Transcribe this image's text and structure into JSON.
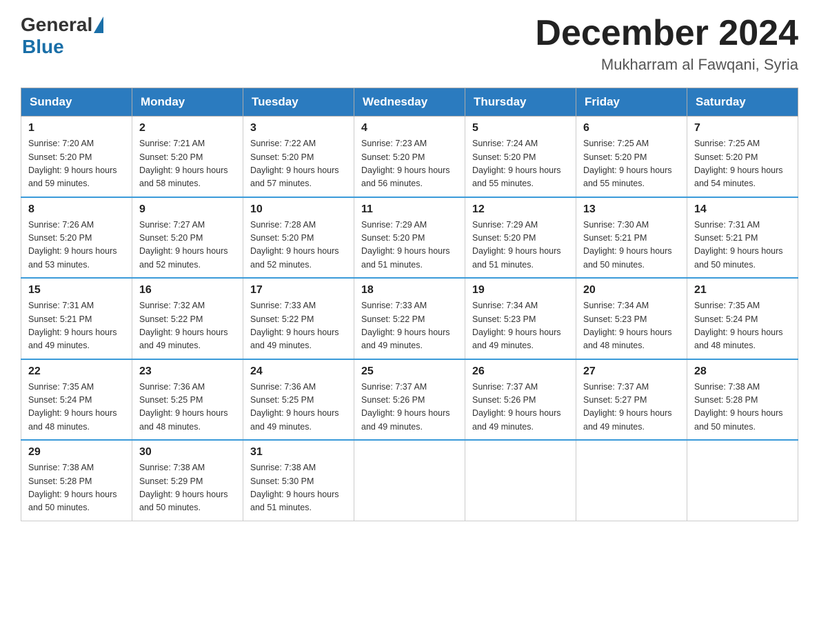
{
  "logo": {
    "general": "General",
    "blue": "Blue"
  },
  "header": {
    "month_title": "December 2024",
    "location": "Mukharram al Fawqani, Syria"
  },
  "weekdays": [
    "Sunday",
    "Monday",
    "Tuesday",
    "Wednesday",
    "Thursday",
    "Friday",
    "Saturday"
  ],
  "weeks": [
    [
      {
        "day": "1",
        "sunrise": "7:20 AM",
        "sunset": "5:20 PM",
        "daylight": "9 hours and 59 minutes."
      },
      {
        "day": "2",
        "sunrise": "7:21 AM",
        "sunset": "5:20 PM",
        "daylight": "9 hours and 58 minutes."
      },
      {
        "day": "3",
        "sunrise": "7:22 AM",
        "sunset": "5:20 PM",
        "daylight": "9 hours and 57 minutes."
      },
      {
        "day": "4",
        "sunrise": "7:23 AM",
        "sunset": "5:20 PM",
        "daylight": "9 hours and 56 minutes."
      },
      {
        "day": "5",
        "sunrise": "7:24 AM",
        "sunset": "5:20 PM",
        "daylight": "9 hours and 55 minutes."
      },
      {
        "day": "6",
        "sunrise": "7:25 AM",
        "sunset": "5:20 PM",
        "daylight": "9 hours and 55 minutes."
      },
      {
        "day": "7",
        "sunrise": "7:25 AM",
        "sunset": "5:20 PM",
        "daylight": "9 hours and 54 minutes."
      }
    ],
    [
      {
        "day": "8",
        "sunrise": "7:26 AM",
        "sunset": "5:20 PM",
        "daylight": "9 hours and 53 minutes."
      },
      {
        "day": "9",
        "sunrise": "7:27 AM",
        "sunset": "5:20 PM",
        "daylight": "9 hours and 52 minutes."
      },
      {
        "day": "10",
        "sunrise": "7:28 AM",
        "sunset": "5:20 PM",
        "daylight": "9 hours and 52 minutes."
      },
      {
        "day": "11",
        "sunrise": "7:29 AM",
        "sunset": "5:20 PM",
        "daylight": "9 hours and 51 minutes."
      },
      {
        "day": "12",
        "sunrise": "7:29 AM",
        "sunset": "5:20 PM",
        "daylight": "9 hours and 51 minutes."
      },
      {
        "day": "13",
        "sunrise": "7:30 AM",
        "sunset": "5:21 PM",
        "daylight": "9 hours and 50 minutes."
      },
      {
        "day": "14",
        "sunrise": "7:31 AM",
        "sunset": "5:21 PM",
        "daylight": "9 hours and 50 minutes."
      }
    ],
    [
      {
        "day": "15",
        "sunrise": "7:31 AM",
        "sunset": "5:21 PM",
        "daylight": "9 hours and 49 minutes."
      },
      {
        "day": "16",
        "sunrise": "7:32 AM",
        "sunset": "5:22 PM",
        "daylight": "9 hours and 49 minutes."
      },
      {
        "day": "17",
        "sunrise": "7:33 AM",
        "sunset": "5:22 PM",
        "daylight": "9 hours and 49 minutes."
      },
      {
        "day": "18",
        "sunrise": "7:33 AM",
        "sunset": "5:22 PM",
        "daylight": "9 hours and 49 minutes."
      },
      {
        "day": "19",
        "sunrise": "7:34 AM",
        "sunset": "5:23 PM",
        "daylight": "9 hours and 49 minutes."
      },
      {
        "day": "20",
        "sunrise": "7:34 AM",
        "sunset": "5:23 PM",
        "daylight": "9 hours and 48 minutes."
      },
      {
        "day": "21",
        "sunrise": "7:35 AM",
        "sunset": "5:24 PM",
        "daylight": "9 hours and 48 minutes."
      }
    ],
    [
      {
        "day": "22",
        "sunrise": "7:35 AM",
        "sunset": "5:24 PM",
        "daylight": "9 hours and 48 minutes."
      },
      {
        "day": "23",
        "sunrise": "7:36 AM",
        "sunset": "5:25 PM",
        "daylight": "9 hours and 48 minutes."
      },
      {
        "day": "24",
        "sunrise": "7:36 AM",
        "sunset": "5:25 PM",
        "daylight": "9 hours and 49 minutes."
      },
      {
        "day": "25",
        "sunrise": "7:37 AM",
        "sunset": "5:26 PM",
        "daylight": "9 hours and 49 minutes."
      },
      {
        "day": "26",
        "sunrise": "7:37 AM",
        "sunset": "5:26 PM",
        "daylight": "9 hours and 49 minutes."
      },
      {
        "day": "27",
        "sunrise": "7:37 AM",
        "sunset": "5:27 PM",
        "daylight": "9 hours and 49 minutes."
      },
      {
        "day": "28",
        "sunrise": "7:38 AM",
        "sunset": "5:28 PM",
        "daylight": "9 hours and 50 minutes."
      }
    ],
    [
      {
        "day": "29",
        "sunrise": "7:38 AM",
        "sunset": "5:28 PM",
        "daylight": "9 hours and 50 minutes."
      },
      {
        "day": "30",
        "sunrise": "7:38 AM",
        "sunset": "5:29 PM",
        "daylight": "9 hours and 50 minutes."
      },
      {
        "day": "31",
        "sunrise": "7:38 AM",
        "sunset": "5:30 PM",
        "daylight": "9 hours and 51 minutes."
      },
      null,
      null,
      null,
      null
    ]
  ]
}
